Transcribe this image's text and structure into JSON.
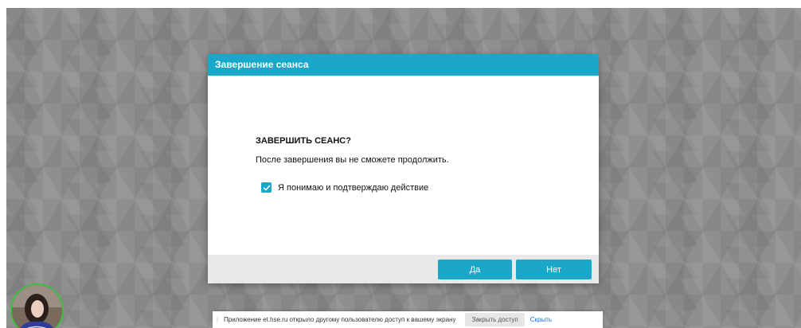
{
  "dialog": {
    "title": "Завершение сеанса",
    "question": "ЗАВЕРШИТЬ СЕАНС?",
    "message": "После завершения вы не сможете продолжить.",
    "confirm_label": "Я понимаю и подтверждаю действие",
    "confirm_checked": true,
    "yes_label": "Да",
    "no_label": "Нет"
  },
  "share_bar": {
    "message": "Приложение et.hse.ru открыло другому пользователю доступ к вашему экрану",
    "stop_label": "Закрыть доступ",
    "hide_label": "Скрыть"
  },
  "colors": {
    "accent": "#1aa7c9",
    "backdrop": "#8f8f8f",
    "footer": "#e9e9ec",
    "avatar_ring": "#3fbf3f",
    "link": "#1a73e8"
  },
  "icons": {
    "checkbox": "checkmark-icon",
    "grip": "drag-handle-icon"
  }
}
